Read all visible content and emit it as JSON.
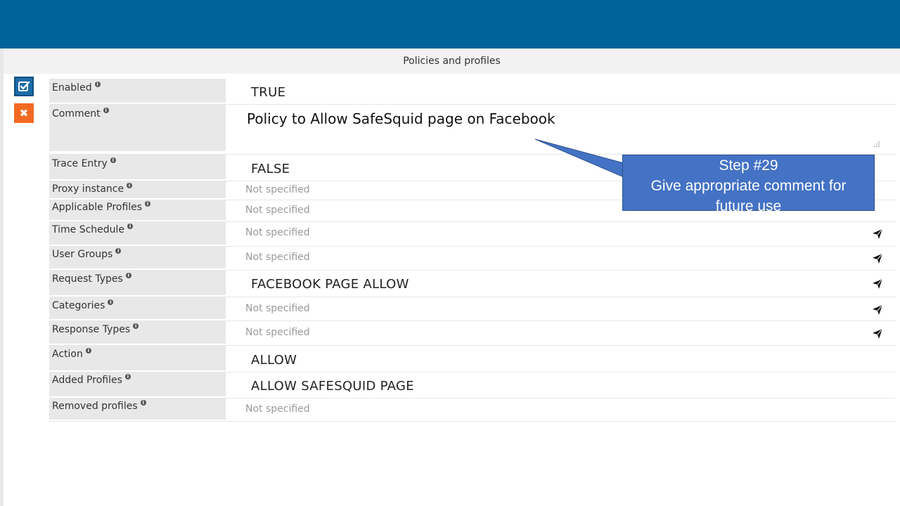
{
  "header": {
    "title": "Policies and profiles"
  },
  "sidebar": {
    "enable_icon": "checkbox-icon",
    "delete_icon": "close-icon",
    "delete_glyph": "✖"
  },
  "fields": {
    "enabled": {
      "label": "Enabled",
      "value": "TRUE"
    },
    "comment": {
      "label": "Comment",
      "value": "Policy to Allow SafeSquid page on Facebook"
    },
    "trace_entry": {
      "label": "Trace Entry",
      "value": "FALSE"
    },
    "proxy_instance": {
      "label": "Proxy instance",
      "value": "Not specified"
    },
    "applicable_profiles": {
      "label": "Applicable Profiles",
      "value": "Not specified"
    },
    "time_schedule": {
      "label": "Time Schedule",
      "value": "Not specified"
    },
    "user_groups": {
      "label": "User Groups",
      "value": "Not specified"
    },
    "request_types": {
      "label": "Request Types",
      "value": "FACEBOOK PAGE ALLOW"
    },
    "categories": {
      "label": "Categories",
      "value": "Not specified"
    },
    "response_types": {
      "label": "Response Types",
      "value": "Not specified"
    },
    "action": {
      "label": "Action",
      "value": "ALLOW"
    },
    "added_profiles": {
      "label": "Added Profiles",
      "value": "ALLOW SAFESQUID PAGE"
    },
    "removed_profiles": {
      "label": "Removed profiles",
      "value": "Not specified"
    }
  },
  "info_glyph": "i",
  "callout": {
    "line1": "Step #29",
    "line2": "Give appropriate comment for",
    "line3": "future use"
  },
  "colors": {
    "topbar": "#00639a",
    "callout": "#4472c4",
    "delete_button": "#f26a21",
    "enable_button": "#1b6ca8"
  }
}
